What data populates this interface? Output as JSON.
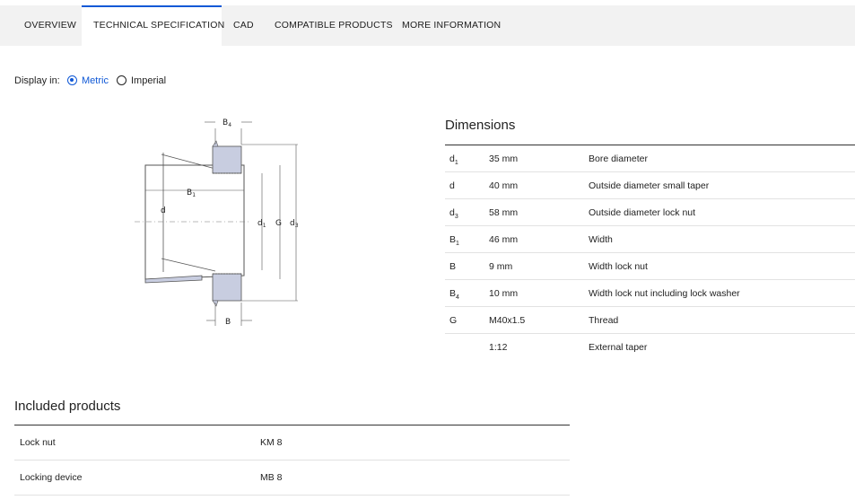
{
  "tabs": [
    {
      "label": "OVERVIEW"
    },
    {
      "label": "TECHNICAL SPECIFICATION"
    },
    {
      "label": "CAD"
    },
    {
      "label": "COMPATIBLE PRODUCTS"
    },
    {
      "label": "MORE INFORMATION"
    }
  ],
  "active_tab": "TECHNICAL SPECIFICATION",
  "display_in": {
    "label": "Display in:",
    "options": [
      "Metric",
      "Imperial"
    ],
    "selected": "Metric"
  },
  "diagram": {
    "labels": {
      "b4": "B",
      "b4_sub": "4",
      "b1": "B",
      "b1_sub": "1",
      "d": "d",
      "d1": "d",
      "d1_sub": "1",
      "g": "G",
      "d3": "d",
      "d3_sub": "3",
      "b": "B"
    }
  },
  "dimensions": {
    "title": "Dimensions",
    "rows": [
      {
        "sym": "d",
        "sub": "1",
        "value": "35 mm",
        "desc": "Bore diameter"
      },
      {
        "sym": "d",
        "sub": "",
        "value": "40 mm",
        "desc": "Outside diameter small taper"
      },
      {
        "sym": "d",
        "sub": "3",
        "value": "58 mm",
        "desc": "Outside diameter lock nut"
      },
      {
        "sym": "B",
        "sub": "1",
        "value": "46 mm",
        "desc": "Width"
      },
      {
        "sym": "B",
        "sub": "",
        "value": "9 mm",
        "desc": "Width lock nut"
      },
      {
        "sym": "B",
        "sub": "4",
        "value": "10 mm",
        "desc": "Width lock nut including lock washer"
      },
      {
        "sym": "G",
        "sub": "",
        "value": "M40x1.5",
        "desc": "Thread"
      },
      {
        "sym": "",
        "sub": "",
        "value": "1:12",
        "desc": "External taper"
      }
    ]
  },
  "included": {
    "title": "Included products",
    "rows": [
      {
        "name": "Lock nut",
        "value": "KM 8"
      },
      {
        "name": "Locking device",
        "value": "MB 8"
      }
    ]
  },
  "colors": {
    "accent": "#0f58d6",
    "tabbar": "#f2f2f2",
    "part_fill": "#c8cde0"
  }
}
